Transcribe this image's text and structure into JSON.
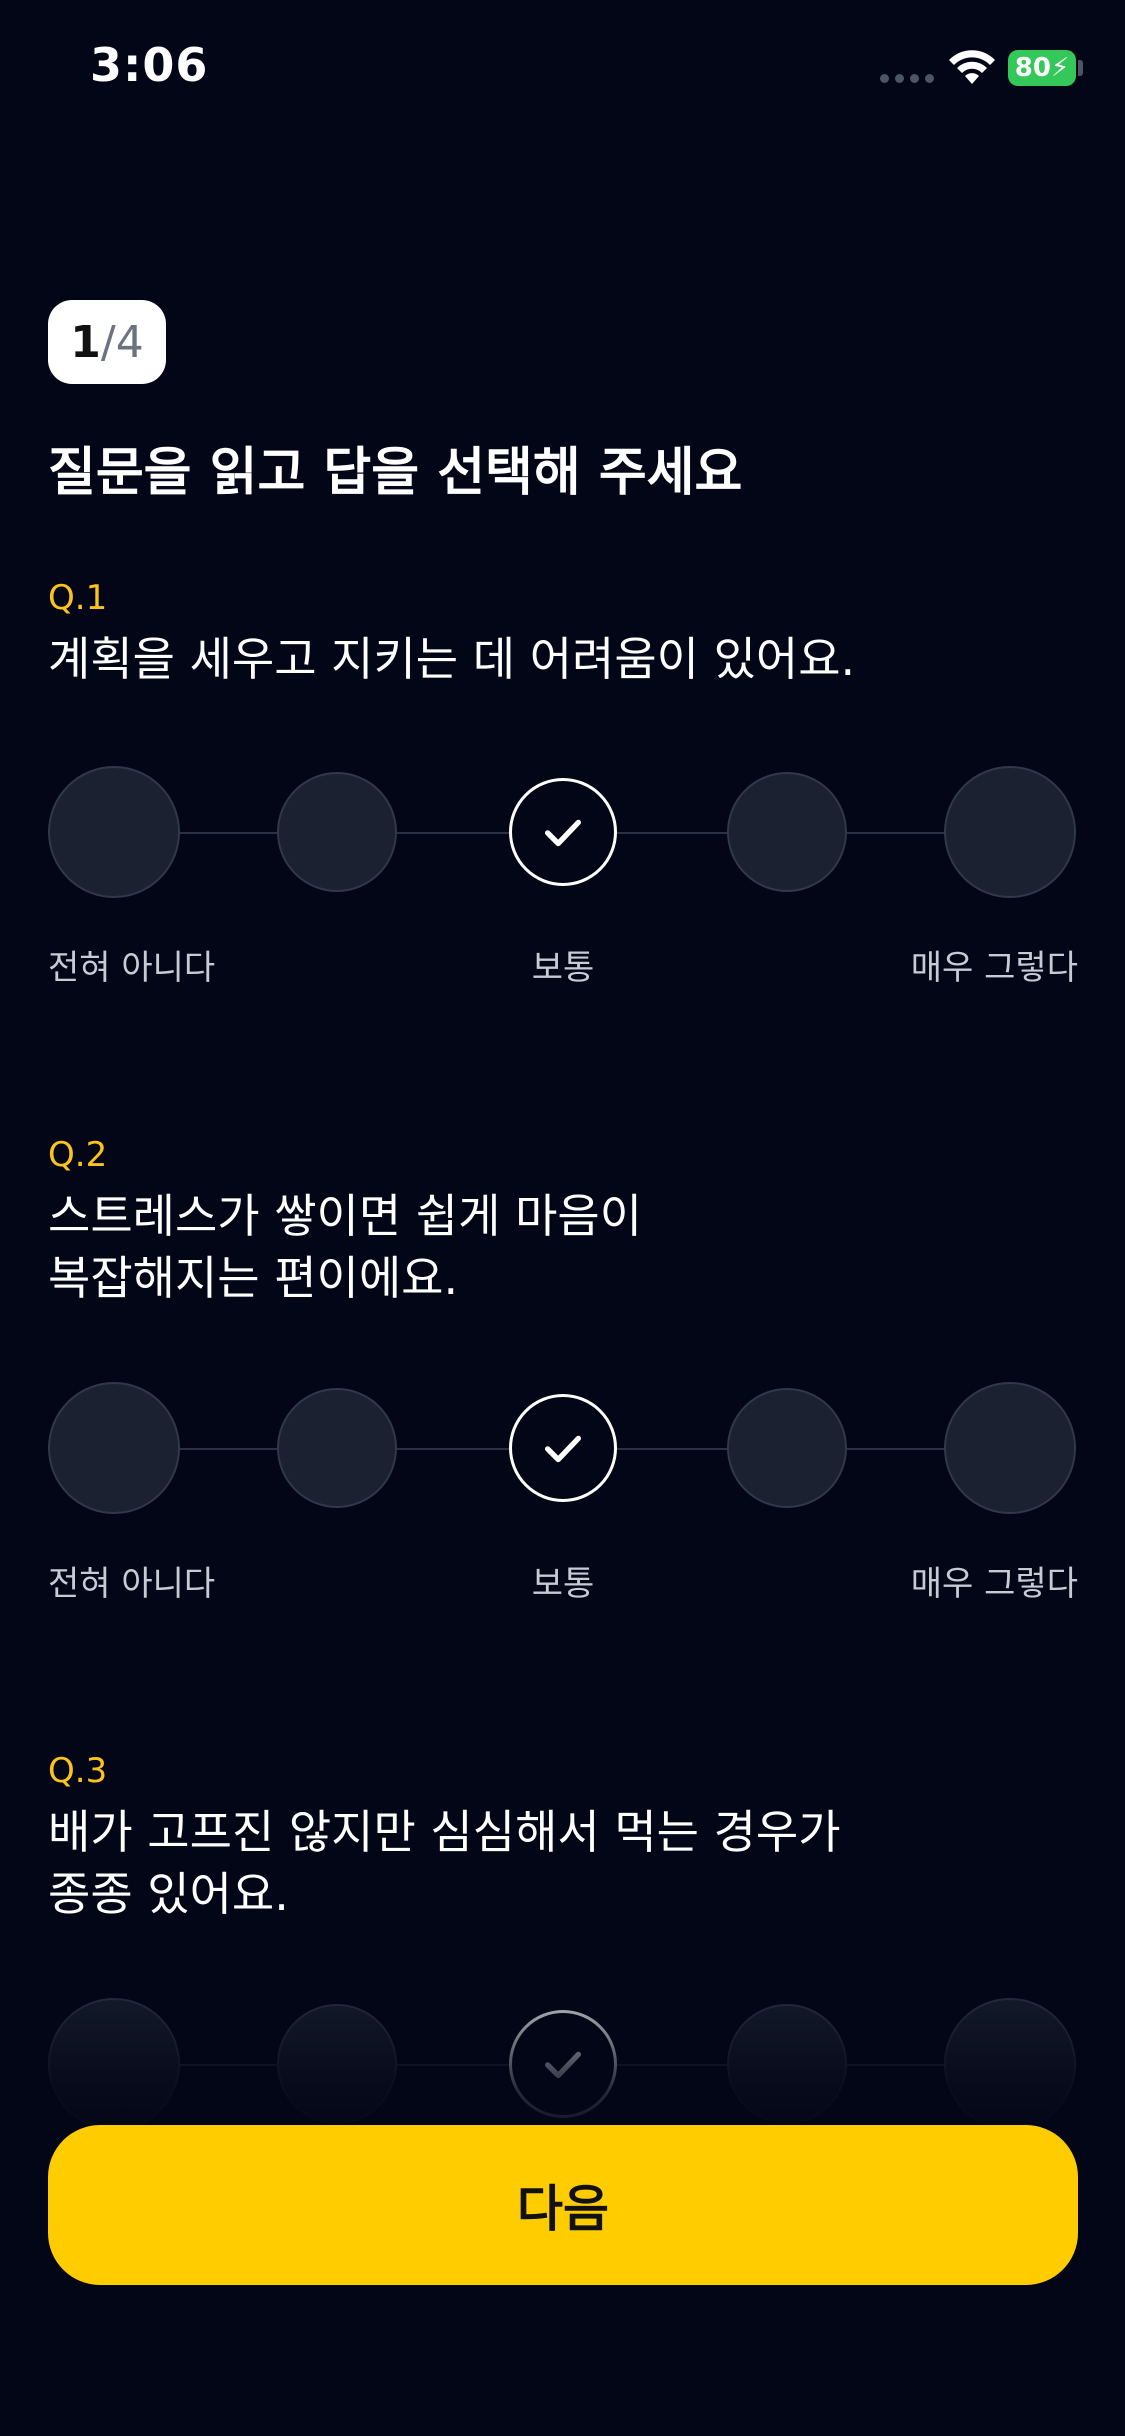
{
  "status_bar": {
    "time": "3:06",
    "battery": "80"
  },
  "step": {
    "current": "1",
    "separator": "/",
    "total": "4"
  },
  "title": "질문을 읽고 답을 선택해 주세요",
  "scale_labels": {
    "left": "전혀 아니다",
    "middle": "보통",
    "right": "매우 그렇다"
  },
  "questions": [
    {
      "number": "Q.1",
      "text": "계획을 세우고 지키는 데 어려움이 있어요.",
      "selected_option": 3,
      "option_count": 5
    },
    {
      "number": "Q.2",
      "text": "스트레스가 쌓이면 쉽게 마음이\n복잡해지는 편이에요.",
      "selected_option": 3,
      "option_count": 5
    },
    {
      "number": "Q.3",
      "text": "배가 고프진 않지만 심심해서 먹는 경우가\n종종 있어요.",
      "selected_option": 3,
      "option_count": 5
    }
  ],
  "next_button": {
    "label": "다음"
  },
  "colors": {
    "background": "#020617",
    "accent": "#ffcc00",
    "question_number": "#fcc419",
    "battery": "#34c759"
  },
  "icons": {
    "wifi": "wifi-icon",
    "check": "check-icon"
  }
}
